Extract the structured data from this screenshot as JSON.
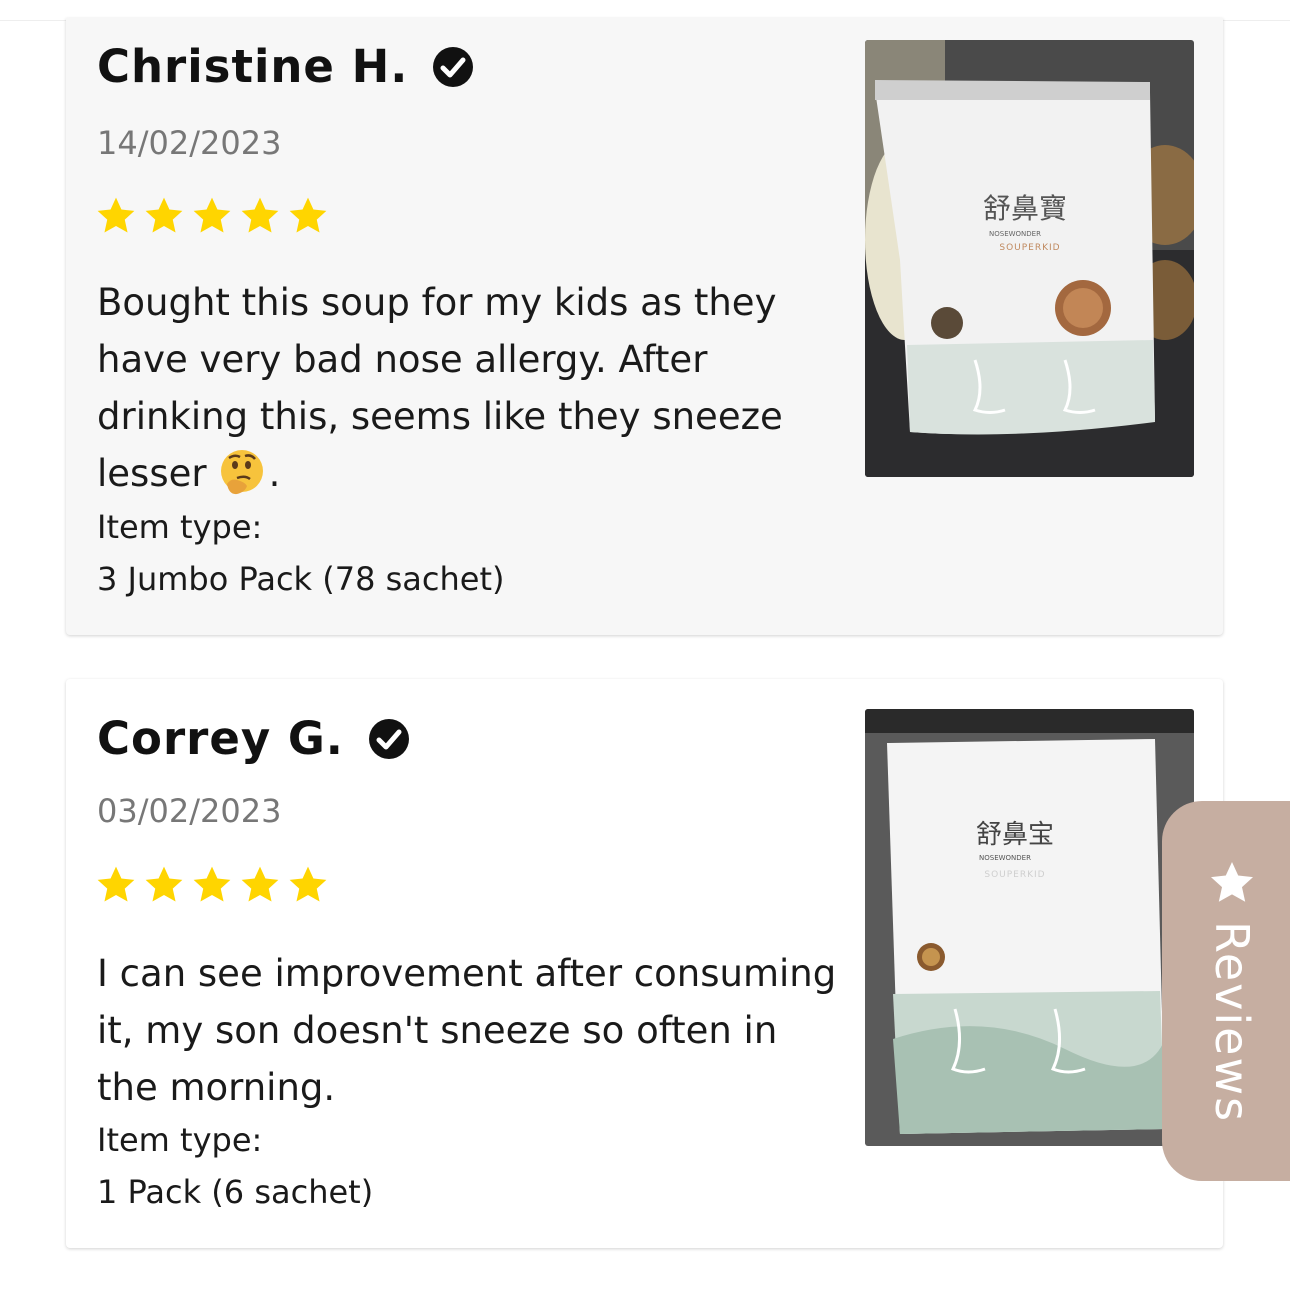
{
  "reviews": [
    {
      "name": "Christine H.",
      "date": "14/02/2023",
      "rating": 5,
      "text": "Bought this soup for my kids as they have very bad nose allergy. After drinking this, seems like they sneeze lesser",
      "emoji": "thinking-face",
      "text_end": ".",
      "item_type_label": "Item type:",
      "item_type_value": "3 Jumbo Pack (78 sachet)",
      "photo_text": {
        "brand_cn": "舒鼻寶",
        "brand_en": "NOSEWONDER",
        "sub": "SOUPERKID"
      }
    },
    {
      "name": "Correy G.",
      "date": "03/02/2023",
      "rating": 5,
      "text": "I can see improvement after consuming it, my son doesn't sneeze so often in the morning.",
      "item_type_label": "Item type:",
      "item_type_value": "1 Pack (6 sachet)",
      "photo_text": {
        "brand_cn": "舒鼻宝",
        "brand_en": "NOSEWONDER",
        "sub": "SOUPERKID"
      }
    }
  ],
  "reviews_tab": {
    "label": "Reviews",
    "icon": "star-icon"
  },
  "colors": {
    "star": "#ffd500",
    "tab_bg": "#c6aea1",
    "card1_bg": "#f7f7f7",
    "date": "#777777"
  }
}
